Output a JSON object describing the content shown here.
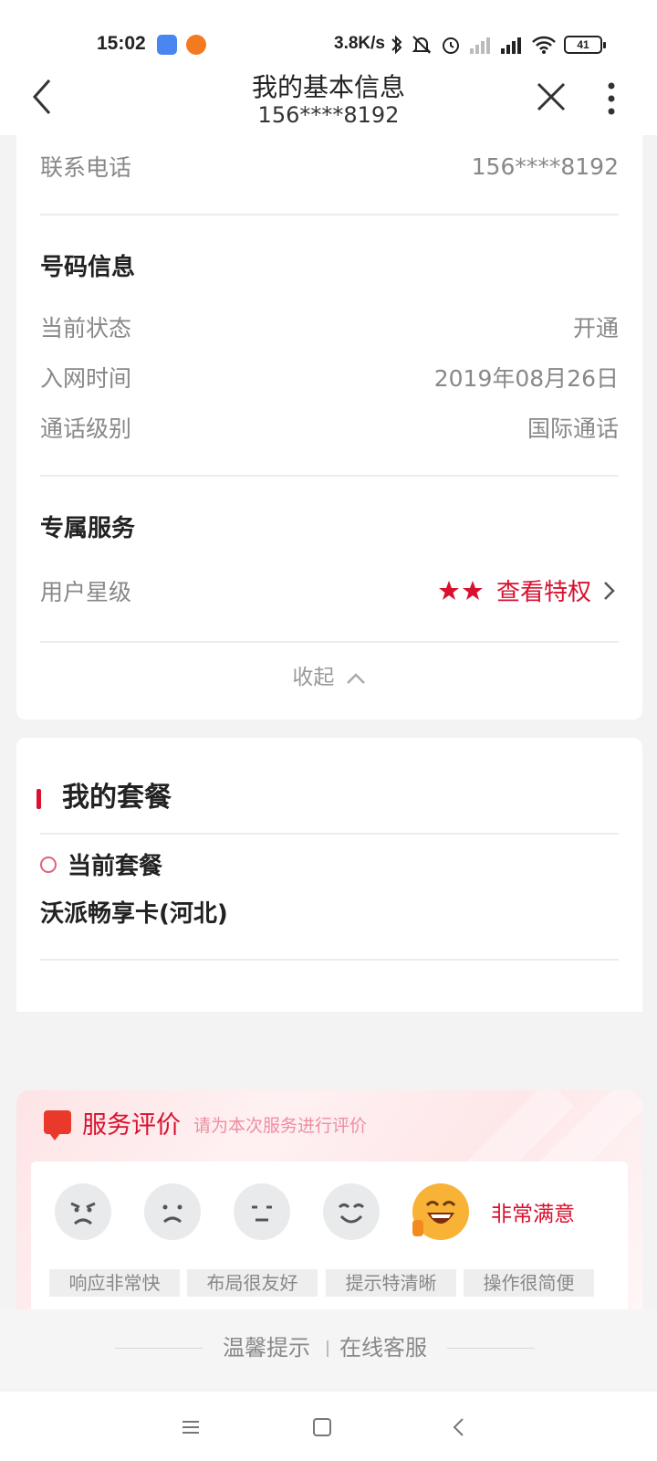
{
  "status_bar": {
    "time": "15:02",
    "net_speed": "3.8K/s",
    "battery": "41",
    "icons": [
      "bluetooth-icon",
      "mute-icon",
      "alarm-icon",
      "signal-icon",
      "wifi-icon"
    ]
  },
  "header": {
    "title": "我的基本信息",
    "subtitle": "156****8192"
  },
  "contact": {
    "label": "联系电话",
    "value": "156****8192"
  },
  "number_info": {
    "title": "号码信息",
    "rows": [
      {
        "label": "当前状态",
        "value": "开通"
      },
      {
        "label": "入网时间",
        "value": "2019年08月26日"
      },
      {
        "label": "通话级别",
        "value": "国际通话"
      }
    ]
  },
  "exclusive_service": {
    "title": "专属服务",
    "star_label": "用户星级",
    "star_count": 2,
    "privilege_link": "查看特权"
  },
  "collapse_label": "收起",
  "package": {
    "title": "我的套餐",
    "current_label": "当前套餐",
    "current_name": "沃派畅享卡(河北)"
  },
  "evaluation": {
    "title": "服务评价",
    "hint": "请为本次服务进行评价",
    "selected_label": "非常满意",
    "selected_level": 5,
    "tags": [
      "响应非常快",
      "布局很友好",
      "提示特清晰",
      "操作很简便"
    ]
  },
  "tips": {
    "warm": "温馨提示",
    "online": "在线客服"
  },
  "colors": {
    "accent": "#d8112f",
    "background": "#f3f3f3"
  }
}
